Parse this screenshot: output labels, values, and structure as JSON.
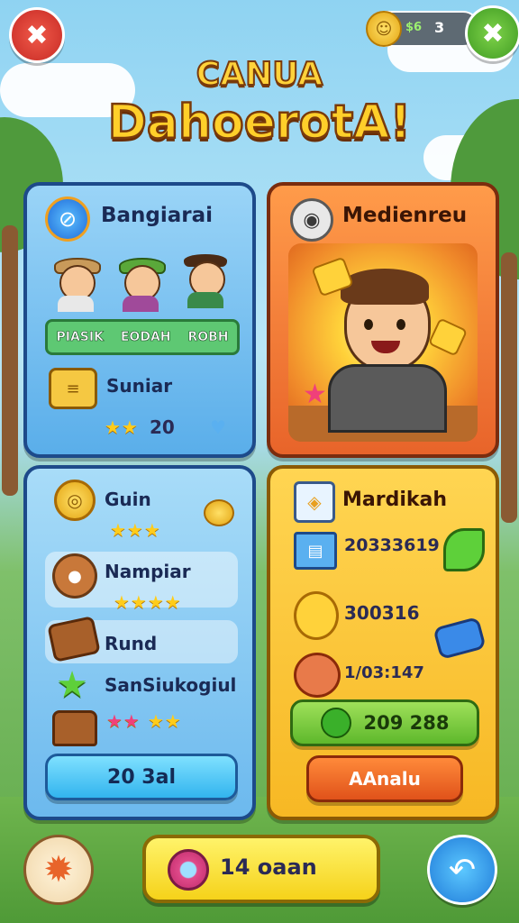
{
  "header": {
    "coin_label": "$6",
    "coin_count": "3",
    "title_top": "CANUA",
    "title_main": "DahoerotA!"
  },
  "panel_top_left": {
    "title": "Bangiarai",
    "names": [
      "PIASIK",
      "EODAH",
      "ROBH"
    ],
    "row_label": "Suniar",
    "stars": "★★",
    "value": "20"
  },
  "panel_top_right": {
    "title": "Medienreu"
  },
  "panel_bottom_left": {
    "rows": [
      {
        "label": "Guin",
        "stars": "★★★"
      },
      {
        "label": "Nampiar",
        "stars": "★★★★"
      },
      {
        "label": "Rund",
        "stars": ""
      },
      {
        "label": "SanSiukogiul",
        "stars": ""
      }
    ],
    "last_stars_pink": "★★",
    "last_stars": "★★",
    "button_label": "20 3al"
  },
  "panel_bottom_right": {
    "title": "Mardikah",
    "values": [
      "20333619",
      "300316",
      "1/03:147"
    ],
    "green_button": "209 288",
    "orange_button": "AAnalu"
  },
  "bottom_bar": {
    "label": "14 oaan"
  },
  "icons": {
    "close": "close-icon",
    "confirm": "check-icon",
    "coin": "coin-icon",
    "globe": "globe-icon",
    "camera": "camera-icon",
    "scroll": "scroll-icon",
    "gold-coin": "gold-coin-icon",
    "cookie": "cookie-icon",
    "wood": "wood-icon",
    "star": "star-icon",
    "chest": "chest-icon",
    "map": "map-icon",
    "book": "book-icon",
    "chick": "chick-icon",
    "creature": "creature-icon",
    "chat": "chat-icon",
    "leaf": "leaf-icon",
    "toy-car": "toy-car-icon",
    "sun-creature": "sun-creature-icon",
    "back": "back-arrow-icon",
    "gem": "gem-icon"
  },
  "colors": {
    "sky": "#8fd3f2",
    "panel_blue": "#5aaeea",
    "panel_orange": "#e8642a",
    "panel_yellow": "#f7b824",
    "title_gold": "#ffcf2a"
  }
}
